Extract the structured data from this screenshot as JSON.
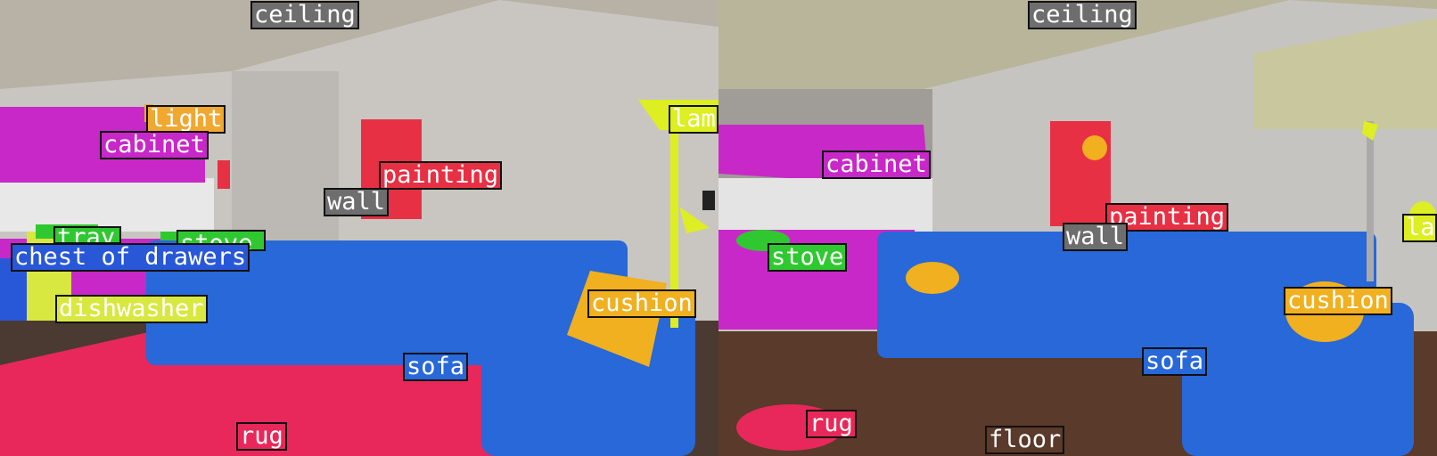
{
  "left_image": {
    "labels": {
      "ceiling": "ceiling",
      "light": "light",
      "cabinet": "cabinet",
      "painting": "painting",
      "wall": "wall",
      "lamp": "lam",
      "tray": "tray",
      "stove": "stove",
      "chest_of_drawers": "chest of drawers",
      "dishwasher": "dishwasher",
      "cushion": "cushion",
      "sofa": "sofa",
      "rug": "rug"
    }
  },
  "right_image": {
    "labels": {
      "ceiling": "ceiling",
      "cabinet": "cabinet",
      "painting": "painting",
      "wall": "wall",
      "lamp": "la",
      "stove": "stove",
      "cushion": "cushion",
      "sofa": "sofa",
      "rug": "rug",
      "floor": "floor"
    }
  },
  "class_colors": {
    "ceiling": "#6e6e6e",
    "light": "#f0a830",
    "cabinet": "#c828c8",
    "painting": "#e83044",
    "wall": "#6e6e6e",
    "lamp": "#ddee22",
    "tray": "#30c830",
    "stove": "#30c830",
    "chest_of_drawers": "#2858d8",
    "dishwasher": "#d8e840",
    "cushion": "#f0b020",
    "sofa": "#2868d8",
    "rug": "#e8285a",
    "floor": "#5a3a2a"
  }
}
